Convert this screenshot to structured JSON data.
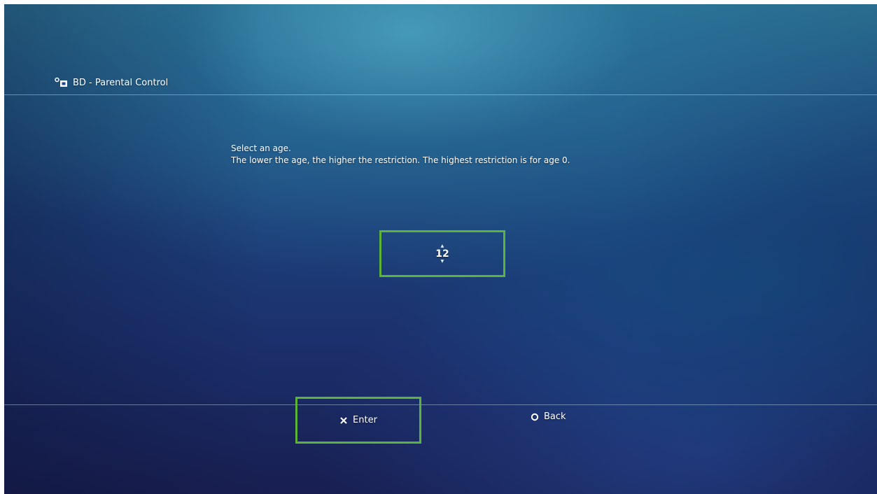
{
  "header": {
    "title": "BD - Parental Control",
    "icon": "parental-control-icon"
  },
  "instructions": {
    "line1": "Select an age.",
    "line2": "The lower the age, the higher the restriction. The highest restriction is for age 0."
  },
  "age_picker": {
    "value": "12",
    "icon": "up-down-spinner-icon"
  },
  "footer": {
    "enter": {
      "label": "Enter",
      "icon": "cross-button-icon"
    },
    "back": {
      "label": "Back",
      "icon": "circle-button-icon"
    }
  },
  "colors": {
    "highlight": "#5db33a",
    "text": "#ffffff",
    "background_top": "#2f7d9e",
    "background_bottom": "#181e50"
  }
}
